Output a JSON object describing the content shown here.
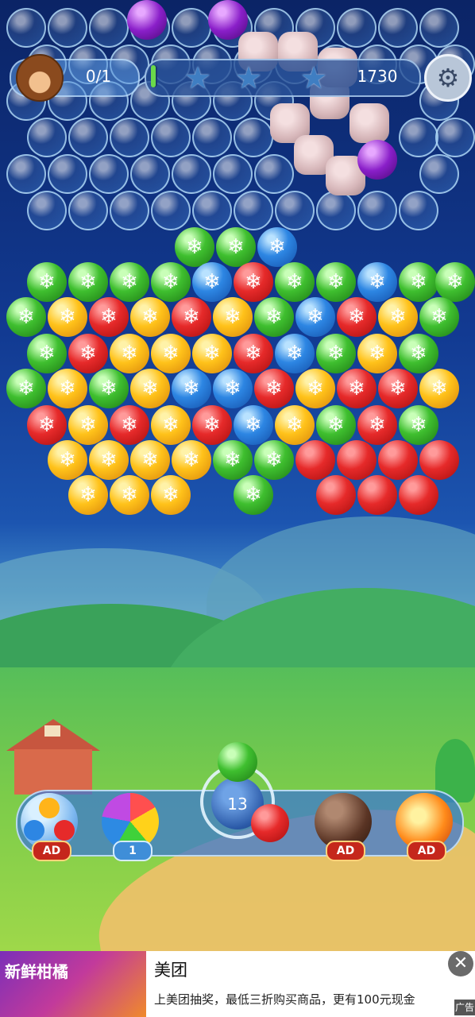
{
  "hud": {
    "goal_progress": "0/1",
    "score": "1730",
    "stars_earned": 0,
    "stars_total": 3,
    "score_bar_fill": 0.02
  },
  "shooter": {
    "shots_left": "13",
    "current_bubble": "green",
    "next_bubble": "red"
  },
  "boosters": [
    {
      "name": "color-bubble-booster",
      "tag": "AD"
    },
    {
      "name": "rainbow-bubble-booster",
      "tag": "1"
    },
    {
      "name": "bomb-booster",
      "tag": "AD"
    },
    {
      "name": "fireball-booster",
      "tag": "AD"
    }
  ],
  "ad": {
    "thumb_text": "新鲜柑橘",
    "title": "美团",
    "description": "上美团抽奖，最低三折购买商品，更有100元现金",
    "close_icon": "close-icon",
    "ad_label": "广告"
  },
  "colors": {
    "red": "#e62a2a",
    "green": "#3fbf2f",
    "yellow": "#ffc21a",
    "blue": "#2d86e3"
  }
}
